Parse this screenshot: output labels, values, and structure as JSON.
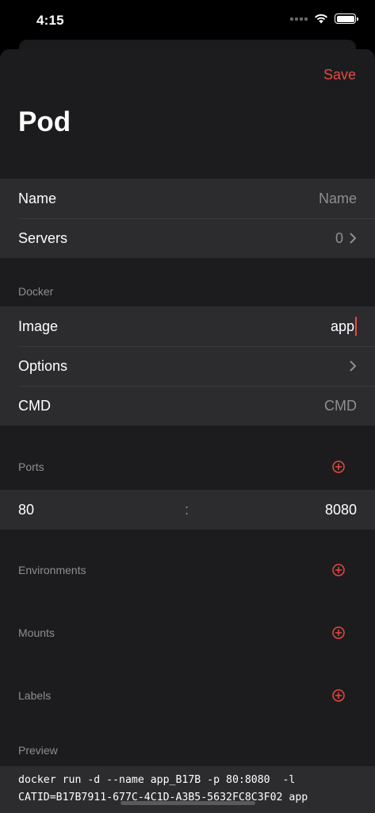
{
  "status": {
    "time": "4:15"
  },
  "nav": {
    "save_label": "Save",
    "title": "Pod"
  },
  "general": {
    "name_label": "Name",
    "name_placeholder": "Name",
    "servers_label": "Servers",
    "servers_count": "0"
  },
  "docker": {
    "header": "Docker",
    "image_label": "Image",
    "image_value": "app",
    "options_label": "Options",
    "cmd_label": "CMD",
    "cmd_placeholder": "CMD"
  },
  "ports": {
    "header": "Ports",
    "host": "80",
    "separator": ":",
    "container": "8080"
  },
  "environments": {
    "header": "Environments"
  },
  "mounts": {
    "header": "Mounts"
  },
  "labels": {
    "header": "Labels"
  },
  "preview": {
    "header": "Preview",
    "line1": "docker run -d --name app_B17B -p 80:8080  -l",
    "line2": "CATID=B17B7911-677C-4C1D-A3B5-5632FC8C3F02 app"
  },
  "colors": {
    "accent": "#e8493f",
    "background": "#1c1c1e",
    "cell": "#2c2c2e",
    "secondary_text": "#8e8e93"
  },
  "icons": [
    "wifi-icon",
    "battery-icon",
    "chevron-right-icon",
    "plus-circle-icon"
  ]
}
